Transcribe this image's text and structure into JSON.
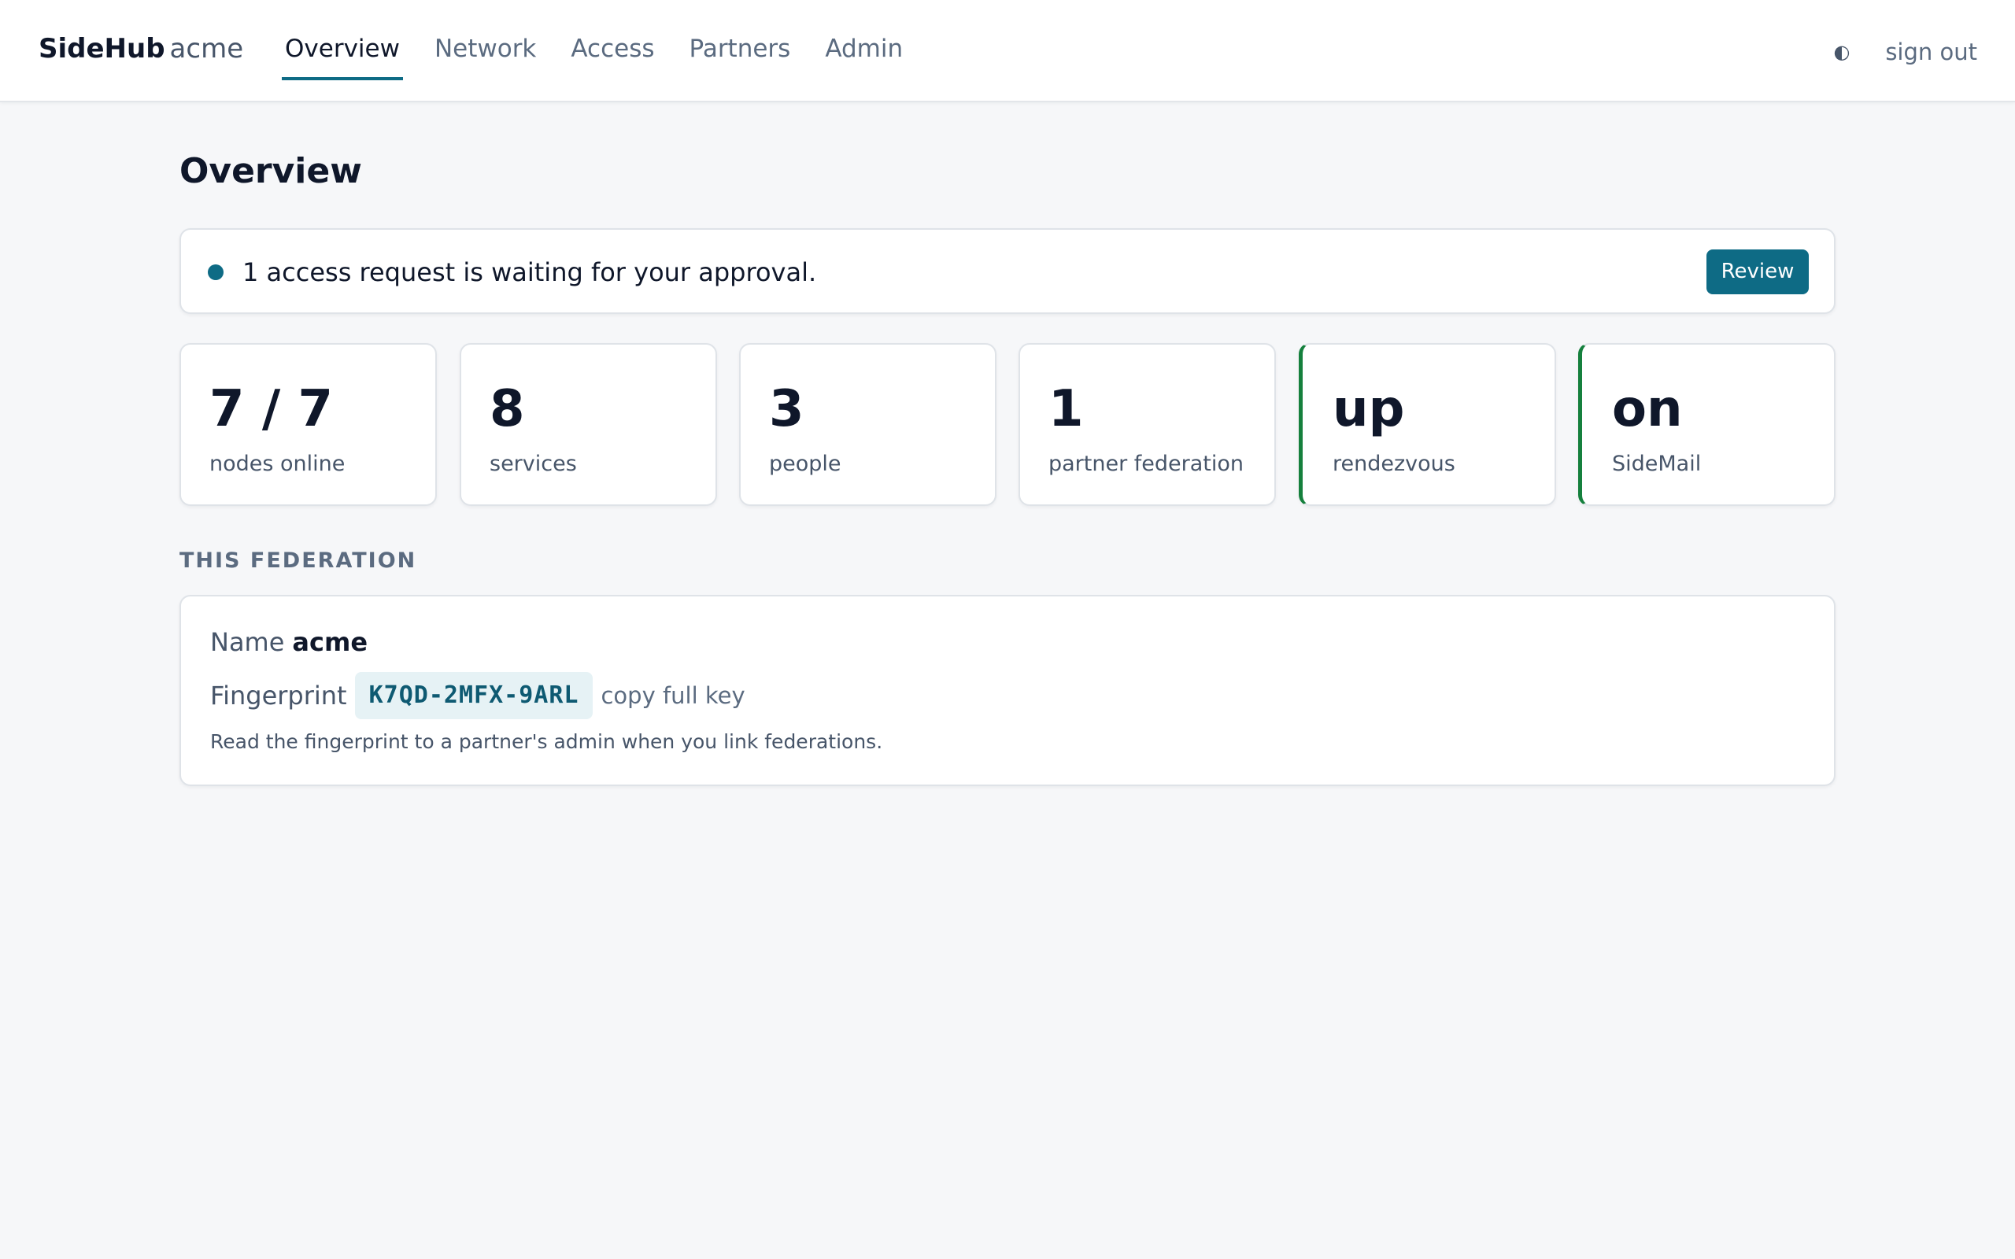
{
  "header": {
    "brand": "SideHub",
    "org": "acme",
    "tabs": [
      {
        "label": "Overview",
        "active": true
      },
      {
        "label": "Network",
        "active": false
      },
      {
        "label": "Access",
        "active": false
      },
      {
        "label": "Partners",
        "active": false
      },
      {
        "label": "Admin",
        "active": false
      }
    ],
    "theme_icon": "◐",
    "signout_label": "sign out"
  },
  "page": {
    "title": "Overview"
  },
  "notice": {
    "text": "1 access request is waiting for your approval.",
    "button_label": "Review"
  },
  "stats": [
    {
      "value": "7 / 7",
      "label": "nodes online"
    },
    {
      "value": "8",
      "label": "services"
    },
    {
      "value": "3",
      "label": "people"
    },
    {
      "value": "1",
      "label": "partner federation"
    },
    {
      "value": "up",
      "label": "rendezvous",
      "status": "ok"
    },
    {
      "value": "on",
      "label": "SideMail",
      "status": "ok"
    }
  ],
  "federation": {
    "heading": "THIS FEDERATION",
    "name_label": "Name",
    "name_value": "acme",
    "fingerprint_label": "Fingerprint",
    "fingerprint_value": "K7QD-2MFX-9ARL",
    "copy_label": "copy full key",
    "hint": "Read the fingerprint to a partner's admin when you link federations."
  },
  "colors": {
    "accent": "#0e6b85",
    "ok": "#15803d",
    "background": "#f6f7f9"
  }
}
